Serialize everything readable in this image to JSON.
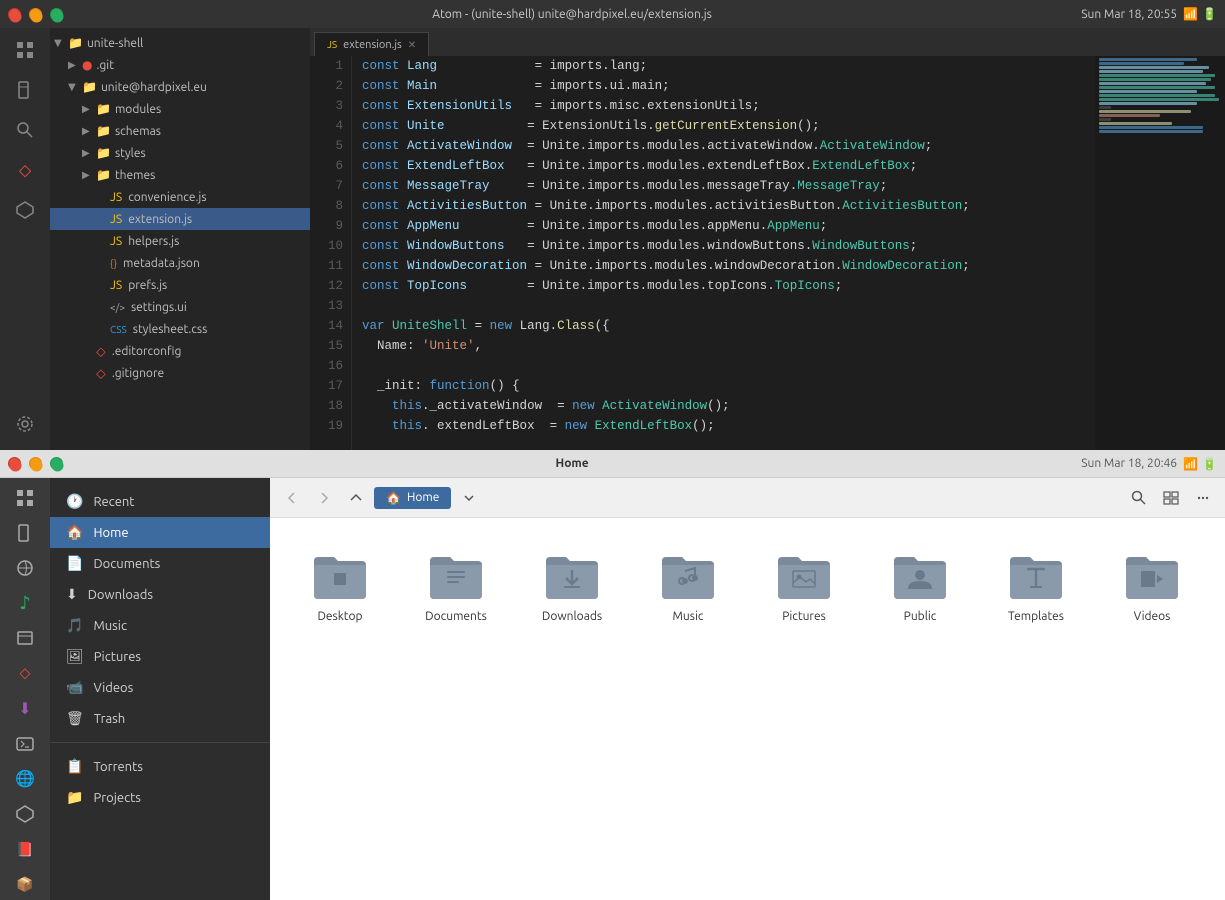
{
  "atom": {
    "title": "Atom - (unite-shell) unite@hardpixel.eu/extension.js",
    "tab": "extension.js",
    "time": "Sun Mar 18, 20:55",
    "tree": {
      "root": "unite-shell",
      "items": [
        {
          "label": ".git",
          "type": "folder",
          "depth": 1,
          "collapsed": true
        },
        {
          "label": "unite@hardpixel.eu",
          "type": "folder",
          "depth": 1,
          "collapsed": false
        },
        {
          "label": "modules",
          "type": "folder",
          "depth": 2,
          "collapsed": true
        },
        {
          "label": "schemas",
          "type": "folder",
          "depth": 2,
          "collapsed": true
        },
        {
          "label": "styles",
          "type": "folder",
          "depth": 2,
          "collapsed": true
        },
        {
          "label": "themes",
          "type": "folder",
          "depth": 2,
          "collapsed": true
        },
        {
          "label": "convenience.js",
          "type": "js",
          "depth": 3
        },
        {
          "label": "extension.js",
          "type": "js",
          "depth": 3,
          "active": true
        },
        {
          "label": "helpers.js",
          "type": "js",
          "depth": 3
        },
        {
          "label": "metadata.json",
          "type": "json",
          "depth": 3
        },
        {
          "label": "prefs.js",
          "type": "js",
          "depth": 3
        },
        {
          "label": "settings.ui",
          "type": "xml",
          "depth": 3
        },
        {
          "label": "stylesheet.css",
          "type": "css",
          "depth": 3
        },
        {
          "label": ".editorconfig",
          "type": "config",
          "depth": 2
        },
        {
          "label": ".gitignore",
          "type": "git",
          "depth": 2
        }
      ]
    },
    "code_lines": [
      {
        "num": 1,
        "code": "<span class='kw'>const</span> <span class='var-name'>Lang</span>             <span class='op'>=</span> imports<span class='op'>.</span>lang<span class='op'>;</span>"
      },
      {
        "num": 2,
        "code": "<span class='kw'>const</span> <span class='var-name'>Main</span>             <span class='op'>=</span> imports<span class='op'>.</span>ui<span class='op'>.</span>main<span class='op'>;</span>"
      },
      {
        "num": 3,
        "code": "<span class='kw'>const</span> <span class='var-name'>ExtensionUtils</span>   <span class='op'>=</span> imports<span class='op'>.</span>misc<span class='op'>.</span>extensionUtils<span class='op'>;</span>"
      },
      {
        "num": 4,
        "code": "<span class='kw'>const</span> <span class='var-name'>Unite</span>           <span class='op'>=</span> ExtensionUtils<span class='op'>.</span><span class='fn'>getCurrentExtension</span><span class='op'>();</span>"
      },
      {
        "num": 5,
        "code": "<span class='kw'>const</span> <span class='var-name'>ActivateWindow</span>  <span class='op'>=</span> Unite<span class='op'>.</span>imports<span class='op'>.</span>modules<span class='op'>.</span>activateWindow<span class='op'>.</span><span class='cls'>ActivateWindow</span><span class='op'>;</span>"
      },
      {
        "num": 6,
        "code": "<span class='kw'>const</span> <span class='var-name'>ExtendLeftBox</span>   <span class='op'>=</span> Unite<span class='op'>.</span>imports<span class='op'>.</span>modules<span class='op'>.</span>extendLeftBox<span class='op'>.</span><span class='cls'>ExtendLeftBox</span><span class='op'>;</span>"
      },
      {
        "num": 7,
        "code": "<span class='kw'>const</span> <span class='var-name'>MessageTray</span>     <span class='op'>=</span> Unite<span class='op'>.</span>imports<span class='op'>.</span>modules<span class='op'>.</span>messageTray<span class='op'>.</span><span class='cls'>MessageTray</span><span class='op'>;</span>"
      },
      {
        "num": 8,
        "code": "<span class='kw'>const</span> <span class='var-name'>ActivitiesButton</span> <span class='op'>=</span> Unite<span class='op'>.</span>imports<span class='op'>.</span>modules<span class='op'>.</span>activitiesButton<span class='op'>.</span><span class='cls'>ActivitiesButton</span><span class='op'>;</span>"
      },
      {
        "num": 9,
        "code": "<span class='kw'>const</span> <span class='var-name'>AppMenu</span>         <span class='op'>=</span> Unite<span class='op'>.</span>imports<span class='op'>.</span>modules<span class='op'>.</span>appMenu<span class='op'>.</span><span class='cls'>AppMenu</span><span class='op'>;</span>"
      },
      {
        "num": 10,
        "code": "<span class='kw'>const</span> <span class='var-name'>WindowButtons</span>   <span class='op'>=</span> Unite<span class='op'>.</span>imports<span class='op'>.</span>modules<span class='op'>.</span>windowButtons<span class='op'>.</span><span class='cls'>WindowButtons</span><span class='op'>;</span>"
      },
      {
        "num": 11,
        "code": "<span class='kw'>const</span> <span class='var-name'>WindowDecoration</span> <span class='op'>=</span> Unite<span class='op'>.</span>imports<span class='op'>.</span>modules<span class='op'>.</span>windowDecoration<span class='op'>.</span><span class='cls'>WindowDecoration</span><span class='op'>;</span>"
      },
      {
        "num": 12,
        "code": "<span class='kw'>const</span> <span class='var-name'>TopIcons</span>        <span class='op'>=</span> Unite<span class='op'>.</span>imports<span class='op'>.</span>modules<span class='op'>.</span>topIcons<span class='op'>.</span><span class='cls'>TopIcons</span><span class='op'>;</span>"
      },
      {
        "num": 13,
        "code": ""
      },
      {
        "num": 14,
        "code": "<span class='kw'>var</span> <span class='cls'>UniteShell</span> <span class='op'>=</span> <span class='kw'>new</span> Lang<span class='op'>.</span><span class='fn'>Class</span><span class='op'>({</span>"
      },
      {
        "num": 15,
        "code": "  Name<span class='op'>:</span> <span class='str'>'Unite'</span><span class='op'>,</span>"
      },
      {
        "num": 16,
        "code": ""
      },
      {
        "num": 17,
        "code": "  _init<span class='op'>:</span> <span class='kw'>function</span><span class='op'>() {</span>"
      },
      {
        "num": 18,
        "code": "    <span class='kw'>this</span><span class='op'>.</span>_activateWindow  <span class='op'>=</span> <span class='kw'>new</span> <span class='cls'>ActivateWindow</span><span class='op'>();</span>"
      },
      {
        "num": 19,
        "code": "    <span class='kw'>this</span><span class='op'>.</span> extendLeftBox  <span class='op'>=</span> <span class='kw'>new</span> <span class='cls'>ExtendLeftBox</span><span class='op'>();</span>"
      }
    ]
  },
  "filemanager": {
    "title": "Home",
    "time": "Sun Mar 18, 20:46",
    "breadcrumb": "Home",
    "sidebar": {
      "items": [
        {
          "label": "Recent",
          "icon": "🕐"
        },
        {
          "label": "Home",
          "icon": "🏠",
          "active": true
        },
        {
          "label": "Documents",
          "icon": "📄"
        },
        {
          "label": "Downloads",
          "icon": "⬇"
        },
        {
          "label": "Music",
          "icon": "🎵"
        },
        {
          "label": "Pictures",
          "icon": "🖼"
        },
        {
          "label": "Videos",
          "icon": "📹"
        },
        {
          "label": "Trash",
          "icon": "🗑"
        },
        {
          "label": "Torrents",
          "icon": "📋"
        },
        {
          "label": "Projects",
          "icon": "📁"
        }
      ]
    },
    "folders": [
      {
        "label": "Desktop",
        "type": "desktop"
      },
      {
        "label": "Documents",
        "type": "documents"
      },
      {
        "label": "Downloads",
        "type": "downloads"
      },
      {
        "label": "Music",
        "type": "music"
      },
      {
        "label": "Pictures",
        "type": "pictures"
      },
      {
        "label": "Public",
        "type": "public"
      },
      {
        "label": "Templates",
        "type": "templates"
      },
      {
        "label": "Videos",
        "type": "videos"
      }
    ]
  },
  "colors": {
    "folder_base": "#7a8a9a",
    "folder_dark": "#5a6a7a",
    "folder_light": "#9aaabb",
    "active_blue": "#3d6ba0",
    "highlight_blue": "#4a90d9"
  }
}
